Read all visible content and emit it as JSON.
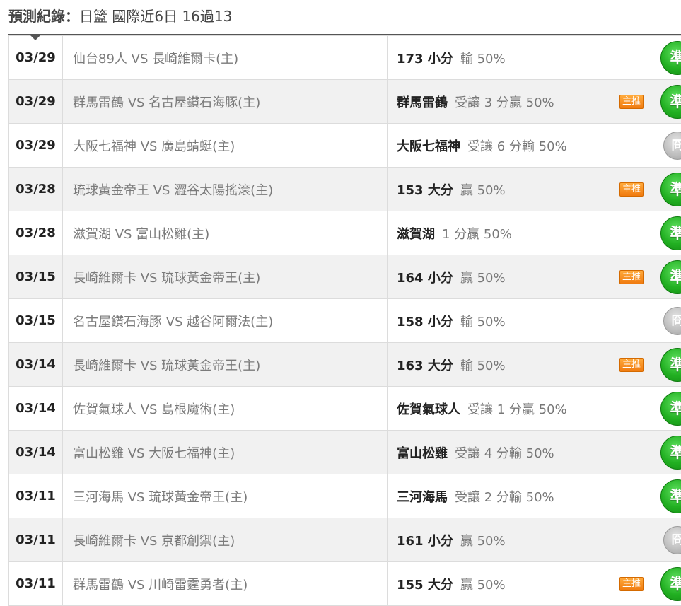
{
  "header": {
    "label": "預測紀錄：",
    "league": "日籃 國際近6日 16過13"
  },
  "colors": {
    "win": "#22b022",
    "push": "#bdbdbd",
    "badge": "#f07b10"
  },
  "rows": [
    {
      "date": "03/29",
      "match": "仙台89人 VS 長崎維爾卡(主)",
      "pick": "173 小分",
      "detail": "輸 50%",
      "badge": "",
      "result": "準",
      "result_type": "win"
    },
    {
      "date": "03/29",
      "match": "群馬雷鶴 VS 名古屋鑽石海豚(主)",
      "pick": "群馬雷鶴",
      "detail": "受讓 3 分贏 50%",
      "badge": "主推",
      "result": "準",
      "result_type": "win"
    },
    {
      "date": "03/29",
      "match": "大阪七福神 VS 廣島蜻蜓(主)",
      "pick": "大阪七福神",
      "detail": "受讓 6 分輸 50%",
      "badge": "",
      "result": "冏",
      "result_type": "push"
    },
    {
      "date": "03/28",
      "match": "琉球黃金帝王 VS 澀谷太陽搖滾(主)",
      "pick": "153 大分",
      "detail": "贏 50%",
      "badge": "主推",
      "result": "準",
      "result_type": "win"
    },
    {
      "date": "03/28",
      "match": "滋賀湖 VS 富山松雞(主)",
      "pick": "滋賀湖",
      "detail": "1 分贏 50%",
      "badge": "",
      "result": "準",
      "result_type": "win"
    },
    {
      "date": "03/15",
      "match": "長崎維爾卡 VS 琉球黃金帝王(主)",
      "pick": "164 小分",
      "detail": "贏 50%",
      "badge": "主推",
      "result": "準",
      "result_type": "win"
    },
    {
      "date": "03/15",
      "match": "名古屋鑽石海豚 VS 越谷阿爾法(主)",
      "pick": "158 小分",
      "detail": "輸 50%",
      "badge": "",
      "result": "冏",
      "result_type": "push"
    },
    {
      "date": "03/14",
      "match": "長崎維爾卡 VS 琉球黃金帝王(主)",
      "pick": "163 大分",
      "detail": "輸 50%",
      "badge": "主推",
      "result": "準",
      "result_type": "win"
    },
    {
      "date": "03/14",
      "match": "佐賀氣球人 VS 島根魔術(主)",
      "pick": "佐賀氣球人",
      "detail": "受讓 1 分贏 50%",
      "badge": "",
      "result": "準",
      "result_type": "win"
    },
    {
      "date": "03/14",
      "match": "富山松雞 VS 大阪七福神(主)",
      "pick": "富山松雞",
      "detail": "受讓 4 分輸 50%",
      "badge": "",
      "result": "準",
      "result_type": "win"
    },
    {
      "date": "03/11",
      "match": "三河海馬 VS 琉球黃金帝王(主)",
      "pick": "三河海馬",
      "detail": "受讓 2 分輸 50%",
      "badge": "",
      "result": "準",
      "result_type": "win"
    },
    {
      "date": "03/11",
      "match": "長崎維爾卡 VS 京都創禦(主)",
      "pick": "161 小分",
      "detail": "贏 50%",
      "badge": "",
      "result": "冏",
      "result_type": "push"
    },
    {
      "date": "03/11",
      "match": "群馬雷鶴 VS 川崎雷霆勇者(主)",
      "pick": "155 大分",
      "detail": "贏 50%",
      "badge": "主推",
      "result": "準",
      "result_type": "win"
    }
  ]
}
